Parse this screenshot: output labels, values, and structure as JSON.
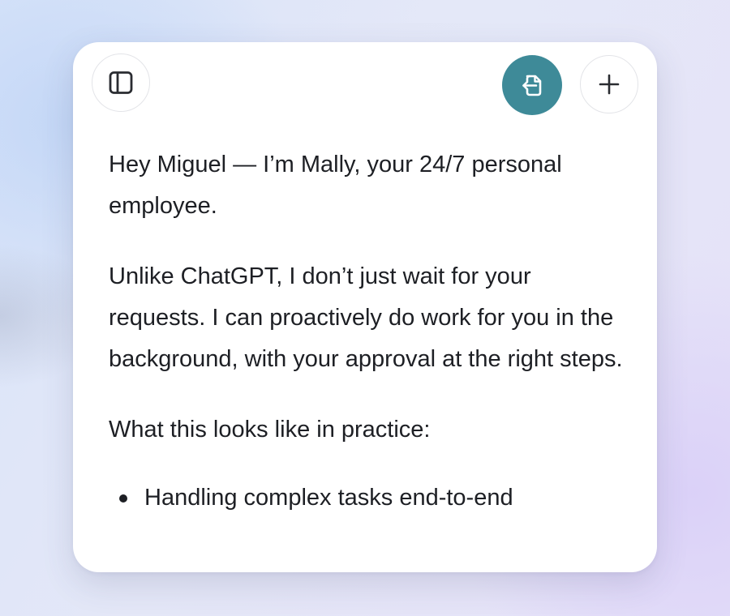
{
  "toolbar": {
    "sidebar_icon": "sidebar-toggle-icon",
    "export_icon": "export-document-icon",
    "new_icon": "plus-icon",
    "accent_color": "#3e8a98"
  },
  "message": {
    "greeting": "Hey Miguel — I’m Mally, your 24/7 personal employee.",
    "description": "Unlike ChatGPT, I don’t just wait for your requests. I can proactively do work for you in the background, with your approval at the right steps.",
    "practice_heading": "What this looks like in practice:",
    "bullets": [
      "Handling complex tasks end-to-end"
    ]
  }
}
